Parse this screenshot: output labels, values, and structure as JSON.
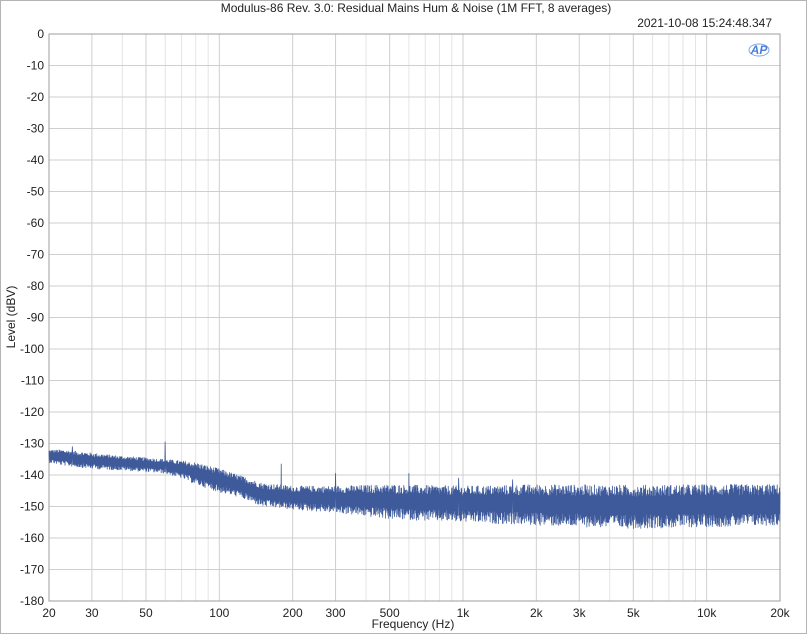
{
  "chart_data": {
    "type": "line",
    "title": "Modulus-86 Rev. 3.0: Residual Mains Hum & Noise (1M FFT, 8 averages)",
    "timestamp": "2021-10-08 15:24:48.347",
    "logo_text": "AP",
    "xlabel": "Frequency (Hz)",
    "ylabel": "Level (dBV)",
    "x_scale": "log",
    "xlim": [
      20,
      20000
    ],
    "ylim": [
      -180,
      0
    ],
    "x_major_ticks": [
      20,
      30,
      50,
      100,
      200,
      300,
      500,
      1000,
      2000,
      3000,
      5000,
      10000,
      20000
    ],
    "x_tick_labels": [
      "20",
      "30",
      "50",
      "100",
      "200",
      "300",
      "500",
      "1k",
      "2k",
      "3k",
      "5k",
      "10k",
      "20k"
    ],
    "x_minor_ticks": [
      40,
      60,
      70,
      80,
      90,
      400,
      600,
      700,
      800,
      900,
      4000,
      6000,
      7000,
      8000,
      9000
    ],
    "y_ticks": [
      0,
      -10,
      -20,
      -30,
      -40,
      -50,
      -60,
      -70,
      -80,
      -90,
      -100,
      -110,
      -120,
      -130,
      -140,
      -150,
      -160,
      -170,
      -180
    ],
    "y_tick_labels": [
      "0",
      "-10",
      "-20",
      "-30",
      "-40",
      "-50",
      "-60",
      "-70",
      "-80",
      "-90",
      "-100",
      "-110",
      "-120",
      "-130",
      "-140",
      "-150",
      "-160",
      "-170",
      "-180"
    ],
    "grid": true,
    "line_color": "#3e5a9b",
    "series": [
      {
        "envelope_upper": [
          [
            20,
            -132
          ],
          [
            23,
            -132
          ],
          [
            26,
            -132.5
          ],
          [
            30,
            -133
          ],
          [
            40,
            -134
          ],
          [
            50,
            -134.5
          ],
          [
            60,
            -135
          ],
          [
            70,
            -135.5
          ],
          [
            80,
            -136
          ],
          [
            100,
            -138
          ],
          [
            120,
            -140
          ],
          [
            150,
            -142.5
          ],
          [
            200,
            -143.5
          ],
          [
            300,
            -143.5
          ],
          [
            500,
            -143
          ],
          [
            1000,
            -143.5
          ],
          [
            2000,
            -143
          ],
          [
            5000,
            -143.2
          ],
          [
            10000,
            -143
          ],
          [
            20000,
            -143
          ]
        ],
        "envelope_lower": [
          [
            20,
            -136
          ],
          [
            23,
            -137
          ],
          [
            26,
            -137.5
          ],
          [
            30,
            -138
          ],
          [
            40,
            -138.5
          ],
          [
            50,
            -139
          ],
          [
            60,
            -139.5
          ],
          [
            70,
            -141
          ],
          [
            80,
            -143
          ],
          [
            100,
            -145.5
          ],
          [
            120,
            -147
          ],
          [
            150,
            -150
          ],
          [
            200,
            -151
          ],
          [
            300,
            -152
          ],
          [
            500,
            -154
          ],
          [
            1000,
            -155
          ],
          [
            2000,
            -156
          ],
          [
            5000,
            -157
          ],
          [
            10000,
            -156.5
          ],
          [
            20000,
            -156
          ]
        ],
        "spikes": [
          [
            25,
            -131
          ],
          [
            60,
            -129.5
          ],
          [
            180,
            -136.5
          ],
          [
            300,
            -139.5
          ],
          [
            600,
            -139.5
          ],
          [
            960,
            -141
          ],
          [
            1600,
            -141.5
          ]
        ]
      }
    ]
  }
}
